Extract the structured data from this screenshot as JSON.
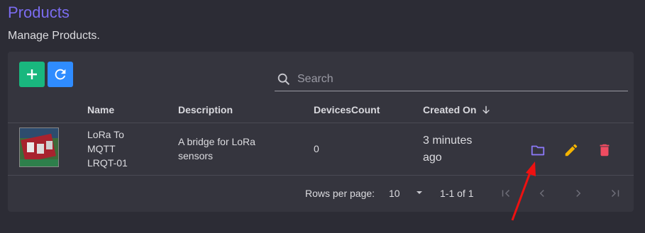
{
  "header": {
    "title": "Products",
    "subtitle": "Manage Products."
  },
  "colors": {
    "accent": "#7b6cf0",
    "add_button": "#19b77e",
    "refresh_button": "#2f8cff",
    "folder_icon": "#8a78f5",
    "edit_icon": "#f5b400",
    "delete_icon": "#ef4c61",
    "annotation_arrow": "#ee1111"
  },
  "toolbar": {
    "add_icon": "plus-icon",
    "refresh_icon": "refresh-icon"
  },
  "search": {
    "placeholder": "Search",
    "value": ""
  },
  "table": {
    "columns": [
      "Name",
      "Description",
      "DevicesCount",
      "Created On"
    ],
    "sort_indicator": "arrow-down-icon",
    "rows": [
      {
        "name_lines": [
          "LoRa To",
          "MQTT",
          "LRQT-01"
        ],
        "description_lines": [
          "A bridge for LoRa",
          "sensors"
        ],
        "devices_count": "0",
        "created_on_lines": [
          "3 minutes",
          "ago"
        ],
        "actions": [
          "folder-icon",
          "pencil-icon",
          "trash-icon"
        ]
      }
    ]
  },
  "pagination": {
    "rows_per_page_label": "Rows per page:",
    "rows_per_page_value": "10",
    "range": "1-1 of 1",
    "buttons": [
      "first-page-icon",
      "previous-page-icon",
      "next-page-icon",
      "last-page-icon"
    ]
  }
}
